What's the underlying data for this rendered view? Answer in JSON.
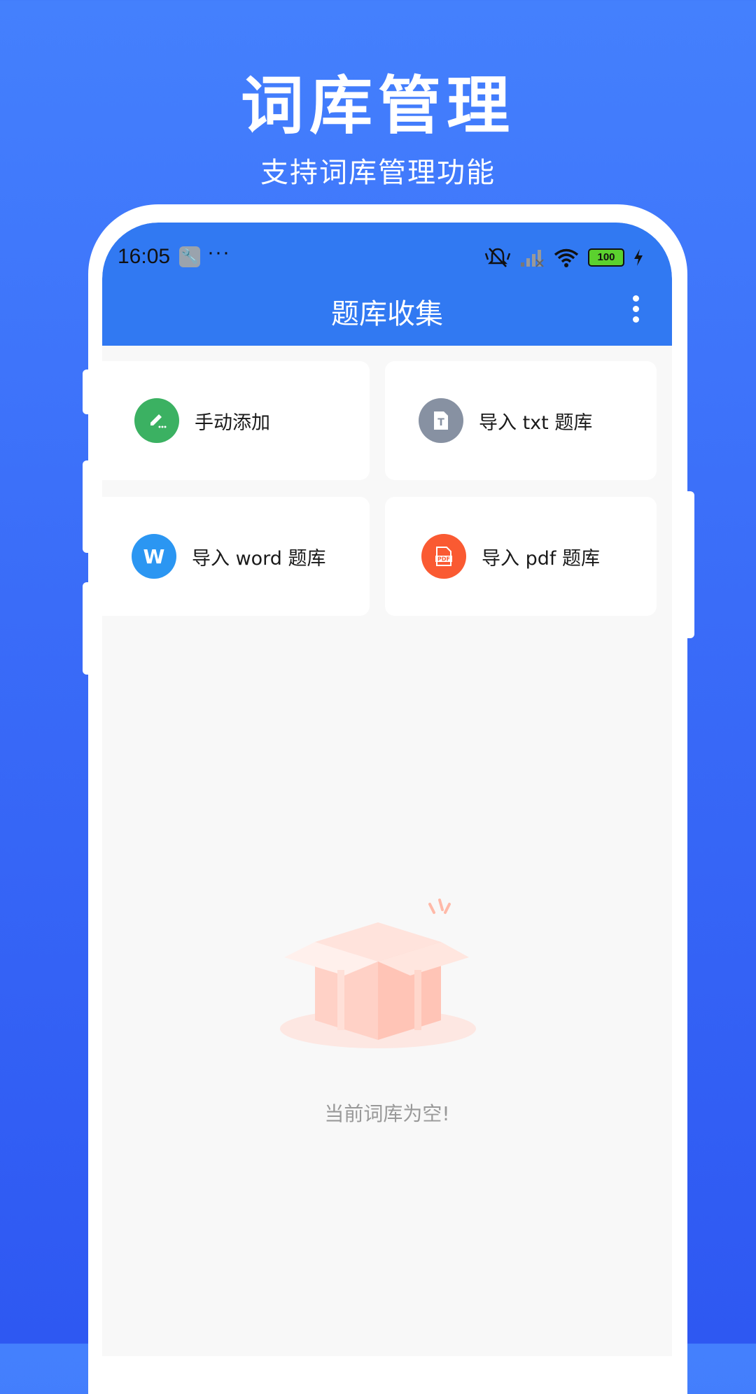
{
  "hero": {
    "title": "词库管理",
    "subtitle": "支持词库管理功能"
  },
  "status_bar": {
    "time": "16:05",
    "more_dots": "···",
    "battery": "100"
  },
  "app_bar": {
    "title": "题库收集"
  },
  "actions": [
    {
      "label": "手动添加",
      "icon": "pencil-icon",
      "color": "#3bb162"
    },
    {
      "label": "导入 txt 题库",
      "icon": "txt-file-icon",
      "color": "#8791a2"
    },
    {
      "label": "导入 word 题库",
      "icon": "word-icon",
      "icon_text": "W",
      "color": "#2b96f2"
    },
    {
      "label": "导入 pdf 题库",
      "icon": "pdf-icon",
      "icon_text": "PDF",
      "color": "#fa5a32"
    }
  ],
  "empty_state": {
    "message": "当前词库为空!",
    "illustration": "empty-box-illustration"
  },
  "colors": {
    "background_top": "#4480fd",
    "background_bottom": "#2e58f2",
    "app_bar": "#3179f2"
  }
}
